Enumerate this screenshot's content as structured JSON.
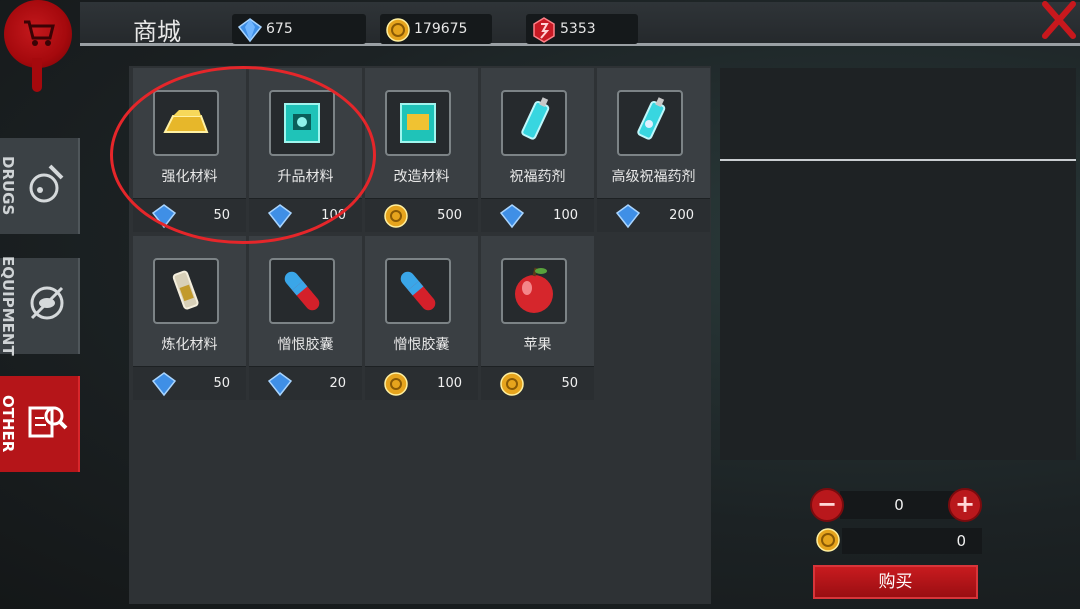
{
  "header": {
    "title": "商城",
    "currencies": [
      {
        "icon": "diamond-icon",
        "value": "675"
      },
      {
        "icon": "gold-coin-icon",
        "value": "179675"
      },
      {
        "icon": "red-crystal-icon",
        "value": "5353"
      }
    ],
    "close_icon": "close-icon"
  },
  "sidebar": {
    "tabs": [
      {
        "label": "DRUGS",
        "icon": "potion-icon",
        "active": false
      },
      {
        "label": "EQUIPMENT",
        "icon": "equipment-icon",
        "active": false
      },
      {
        "label": "OTHER",
        "icon": "document-search-icon",
        "active": true
      }
    ]
  },
  "items": [
    {
      "name": "强化材料",
      "icon": "gold-bar-icon",
      "currency": "diamond",
      "price": "50"
    },
    {
      "name": "升品材料",
      "icon": "blue-chip-icon",
      "currency": "diamond",
      "price": "100"
    },
    {
      "name": "改造材料",
      "icon": "gold-chip-icon",
      "currency": "coin",
      "price": "500"
    },
    {
      "name": "祝福药剂",
      "icon": "syringe-icon",
      "currency": "diamond",
      "price": "100"
    },
    {
      "name": "高级祝福药剂",
      "icon": "syringe-advanced-icon",
      "currency": "diamond",
      "price": "200"
    },
    {
      "name": "炼化材料",
      "icon": "vial-icon",
      "currency": "diamond",
      "price": "50"
    },
    {
      "name": "憎恨胶囊",
      "icon": "capsule-icon",
      "currency": "diamond",
      "price": "20"
    },
    {
      "name": "憎恨胶囊",
      "icon": "capsule-icon",
      "currency": "coin",
      "price": "100"
    },
    {
      "name": "苹果",
      "icon": "apple-icon",
      "currency": "coin",
      "price": "50"
    }
  ],
  "purchase": {
    "quantity": "0",
    "total": "0",
    "minus_label": "−",
    "plus_label": "+",
    "buy_label": "购买"
  },
  "colors": {
    "accent_red": "#b9181c",
    "panel": "#3a3f43",
    "annotation": "#e5262a"
  }
}
